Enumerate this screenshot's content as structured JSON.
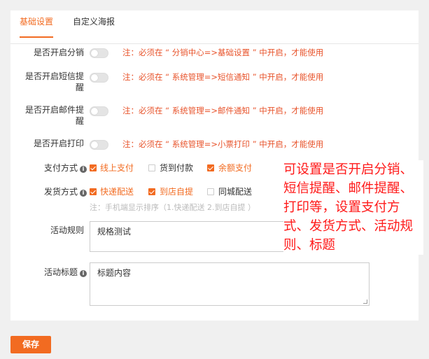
{
  "tabs": [
    {
      "label": "基础设置",
      "active": true
    },
    {
      "label": "自定义海报",
      "active": false
    }
  ],
  "settings": [
    {
      "label": "是否开启分销",
      "enabled": false,
      "note": "注：必须在 “ 分销中心=>基础设置 ” 中开启，才能使用"
    },
    {
      "label": "是否开启短信提醒",
      "enabled": false,
      "note": "注：必须在 “ 系统管理=>短信通知 ” 中开启，才能使用"
    },
    {
      "label": "是否开启邮件提醒",
      "enabled": false,
      "note": "注：必须在 “ 系统管理=>邮件通知 ” 中开启，才能使用"
    },
    {
      "label": "是否开启打印",
      "enabled": false,
      "note": "注：必须在 “ 系统管理=>小票打印 ” 中开启，才能使用"
    }
  ],
  "payment": {
    "label": "支付方式",
    "options": [
      {
        "label": "线上支付",
        "checked": true
      },
      {
        "label": "货到付款",
        "checked": false
      },
      {
        "label": "余额支付",
        "checked": true
      }
    ]
  },
  "delivery": {
    "label": "发货方式",
    "options": [
      {
        "label": "快递配送",
        "checked": true
      },
      {
        "label": "到店自提",
        "checked": true
      },
      {
        "label": "同城配送",
        "checked": false
      }
    ],
    "hint": "注：手机端显示排序（1.快递配送 2.到店自提 ）"
  },
  "rules": {
    "label": "活动规则",
    "value": "规格测试"
  },
  "title": {
    "label": "活动标题",
    "value": "标题内容"
  },
  "annotation": "可设置是否开启分销、短信提醒、邮件提醒、打印等，设置支付方式、发货方式、活动规则、标题",
  "save_label": "保存",
  "colors": {
    "accent": "#f26b21",
    "note": "#e8542c",
    "annotation": "#ff1a1a"
  }
}
